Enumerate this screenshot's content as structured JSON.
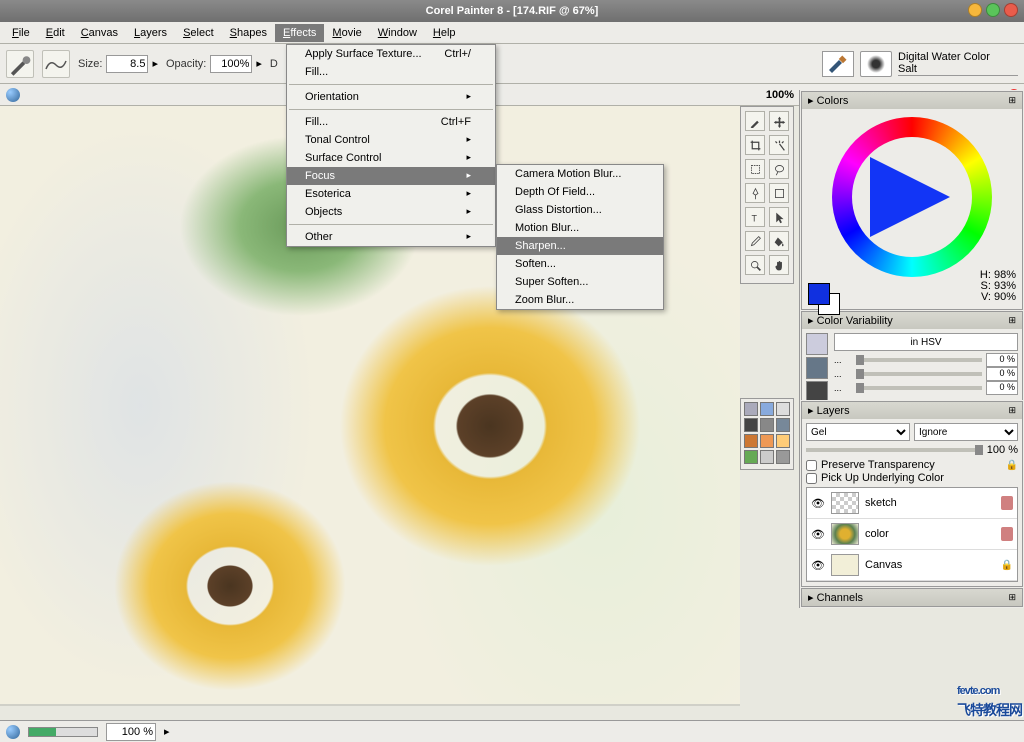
{
  "title": "Corel Painter 8 - [174.RIF @ 67%]",
  "menu": {
    "items": [
      "File",
      "Edit",
      "Canvas",
      "Layers",
      "Select",
      "Shapes",
      "Effects",
      "Movie",
      "Window",
      "Help"
    ],
    "active_index": 6
  },
  "toolbar": {
    "size_label": "Size:",
    "size_value": "8.5",
    "opacity_label": "Opacity:",
    "opacity_value": "100%",
    "brush_category": "Digital Water Color",
    "brush_variant": "Salt"
  },
  "zoom_display": "100%",
  "effects_menu": {
    "items": [
      {
        "label": "Apply Surface Texture...",
        "shortcut": "Ctrl+/"
      },
      {
        "label": "Fill...",
        "shortcut": ""
      },
      {
        "sep": true
      },
      {
        "label": "Orientation",
        "sub": true
      },
      {
        "sep": true
      },
      {
        "label": "Fill...",
        "shortcut": "Ctrl+F"
      },
      {
        "label": "Tonal Control",
        "sub": true
      },
      {
        "label": "Surface Control",
        "sub": true
      },
      {
        "label": "Focus",
        "sub": true,
        "hot": true
      },
      {
        "label": "Esoterica",
        "sub": true
      },
      {
        "label": "Objects",
        "sub": true
      },
      {
        "sep": true
      },
      {
        "label": "Other",
        "sub": true
      }
    ]
  },
  "focus_submenu": {
    "items": [
      {
        "label": "Camera Motion Blur..."
      },
      {
        "label": "Depth Of Field..."
      },
      {
        "label": "Glass Distortion..."
      },
      {
        "label": "Motion Blur..."
      },
      {
        "label": "Sharpen...",
        "hot": true
      },
      {
        "label": "Soften..."
      },
      {
        "label": "Super Soften..."
      },
      {
        "label": "Zoom Blur..."
      }
    ]
  },
  "colors_panel": {
    "title": "Colors",
    "hsv": {
      "h": "H: 98%",
      "s": "S: 93%",
      "v": "V: 90%"
    }
  },
  "color_var_panel": {
    "title": "Color Variability",
    "mode": "in HSV",
    "sliders": [
      {
        "label": "...",
        "value": "0 %"
      },
      {
        "label": "...",
        "value": "0 %"
      },
      {
        "label": "...",
        "value": "0 %"
      }
    ]
  },
  "layers_panel": {
    "title": "Layers",
    "blend": "Gel",
    "method": "Ignore",
    "opacity": "100 %",
    "preserve_transparency": "Preserve Transparency",
    "pick_up_color": "Pick Up Underlying Color",
    "layers": [
      {
        "name": "sketch",
        "visible": true,
        "thumb": "checker",
        "extra": true
      },
      {
        "name": "color",
        "visible": true,
        "thumb": "flower",
        "extra": true
      },
      {
        "name": "Canvas",
        "visible": true,
        "thumb": "canvas",
        "lock": true
      }
    ]
  },
  "channels_panel": {
    "title": "Channels"
  },
  "statusbar": {
    "zoom": "100 %"
  },
  "watermark": {
    "domain": "fevte.com",
    "cn": "飞特教程网"
  }
}
